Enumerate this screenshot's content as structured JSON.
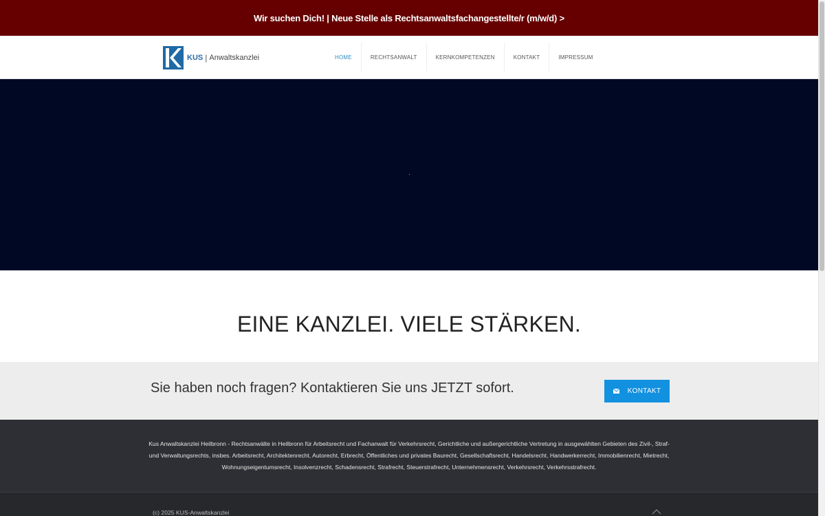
{
  "banner": {
    "text": "Wir suchen Dich! | Neue Stelle als Rechtsanwaltsfachangestellte/r (m/w/d) >"
  },
  "logo": {
    "brand": "KUS",
    "separator": "|",
    "name": "Anwaltskanzlei",
    "icon": "k-logo-mark"
  },
  "nav": {
    "items": [
      {
        "label": "HOME"
      },
      {
        "label": "RECHTSANWALT"
      },
      {
        "label": "KERNKOMPETENZEN"
      },
      {
        "label": "KONTAKT"
      },
      {
        "label": "IMPRESSUM"
      }
    ]
  },
  "headline": {
    "text": "EINE KANZLEI. VIELE STÄRKEN."
  },
  "cta": {
    "text": "Sie haben noch fragen? Kontaktieren Sie uns JETZT sofort.",
    "button_label": "KONTAKT",
    "button_icon": "mail-icon"
  },
  "footer": {
    "text": "Kus Anwaltskanzlei Heilbronn - Rechtsanwälte in Heilbronn für Arbeitsrecht und Fachanwalt für Verkehrsrecht, Gerichtliche und außergerichtliche Vertretung in ausgewählten Gebieten des Zivil-, Straf- und Verwaltungsrechts, insbes. Arbeitsrecht, Architektenrecht, Autorecht, Erbrecht, Öffentliches und privates Baurecht, Gesellschaftsrecht, Handelsrecht, Handwerkerrecht, Immobilienrecht, Mietrecht, Wohnungseigentumsrecht, Insolvenzrecht, Schadensrecht, Strafrecht, Steuerstrafrecht, Unternehmensrecht, Verkehrsrecht, Verkehrsstrafrecht.",
    "copyright": "(c) 2025 KUS-Anwaltskanzlei",
    "to_top_icon": "chevron-up-icon"
  },
  "colors": {
    "banner_bg": "#660000",
    "hero_bg": "#000824",
    "accent": "#1291e0",
    "nav_active": "#2a8fc8",
    "footer_bg": "#2d2f34"
  }
}
